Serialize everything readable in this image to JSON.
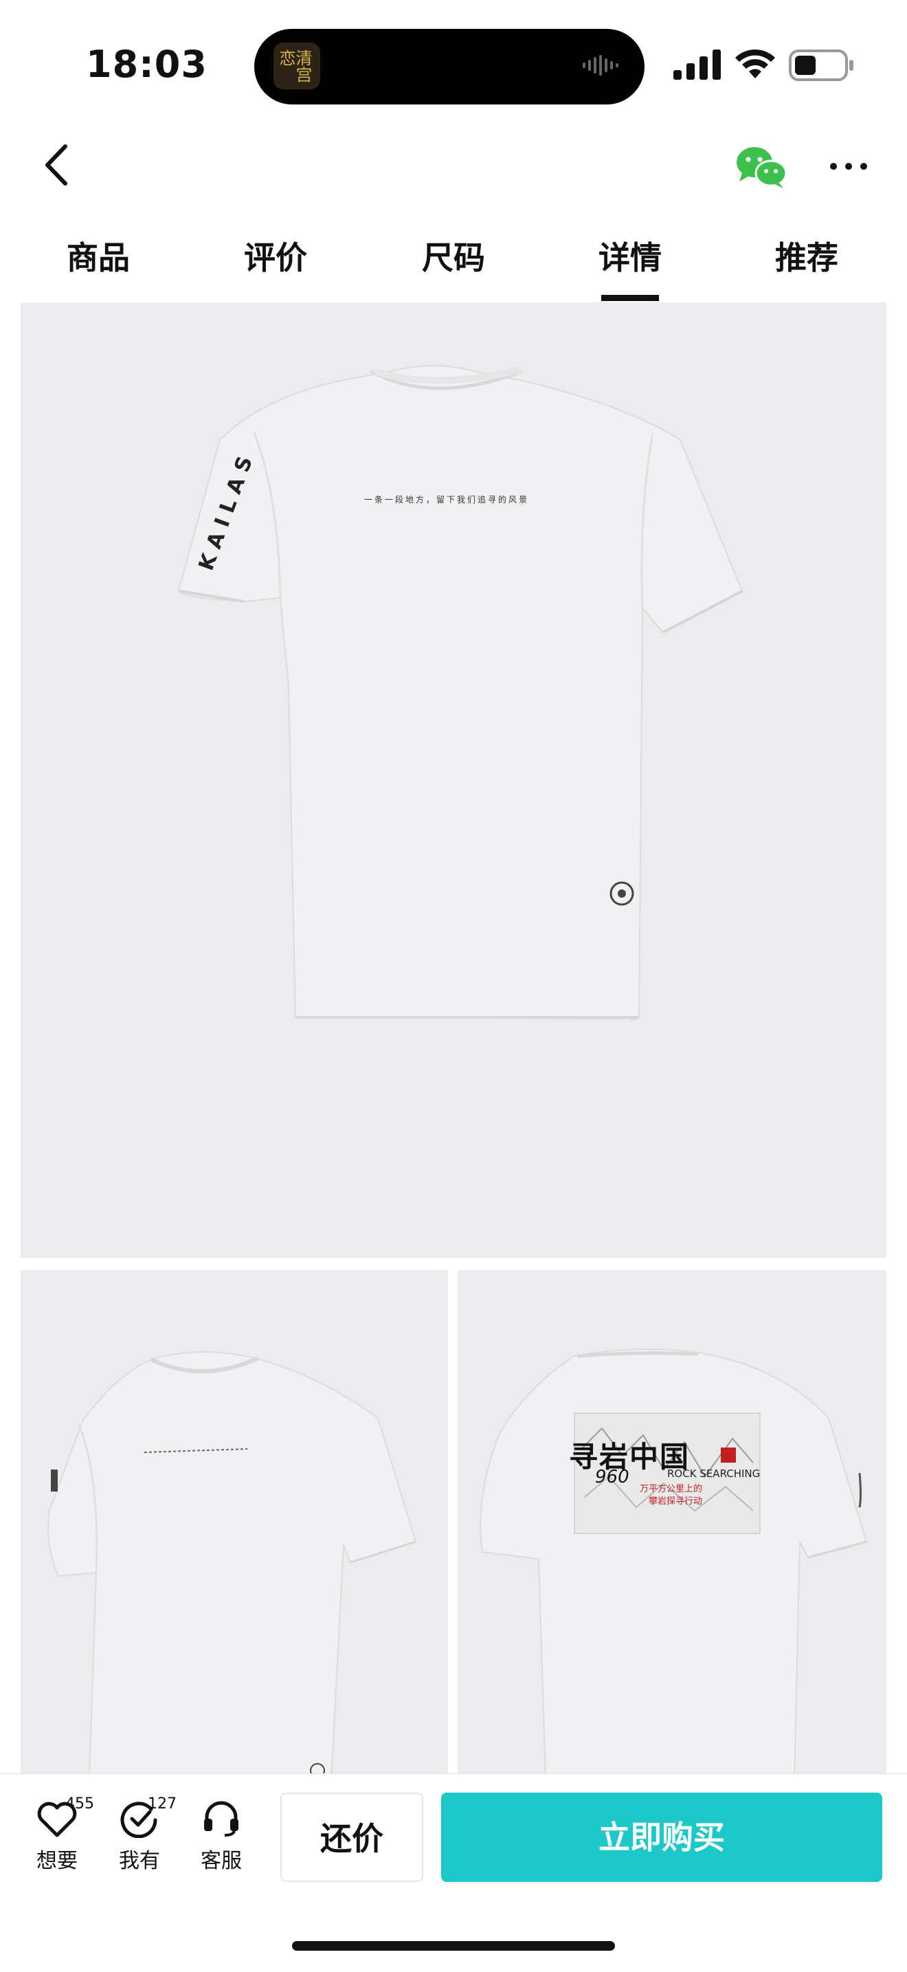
{
  "status_bar": {
    "time": "18:03",
    "island_app_text": "清宫恋"
  },
  "nav": {
    "back_icon": "chevron-left-icon",
    "share_icon": "wechat-icon",
    "more_icon": "more-icon"
  },
  "tabs": [
    {
      "label": "商品"
    },
    {
      "label": "评价"
    },
    {
      "label": "尺码"
    },
    {
      "label": "详情"
    },
    {
      "label": "推荐"
    }
  ],
  "active_tab": "详情",
  "images": {
    "main_chest_text": "一条一段地方，留下我们追寻的风景",
    "back_print": {
      "title_cn": "寻岩中国",
      "number": "960",
      "subtitle_en": "ROCK SEARCHING",
      "line1": "万平方公里上的",
      "line2": "攀岩探寻行动"
    }
  },
  "bottom_bar": {
    "want": {
      "label": "想要",
      "count": "455"
    },
    "have": {
      "label": "我有",
      "count": "127"
    },
    "service": {
      "label": "客服"
    },
    "bargain_label": "还价",
    "buy_label": "立即购买"
  },
  "colors": {
    "accent": "#1ec8c8",
    "image_bg": "#ececee"
  }
}
